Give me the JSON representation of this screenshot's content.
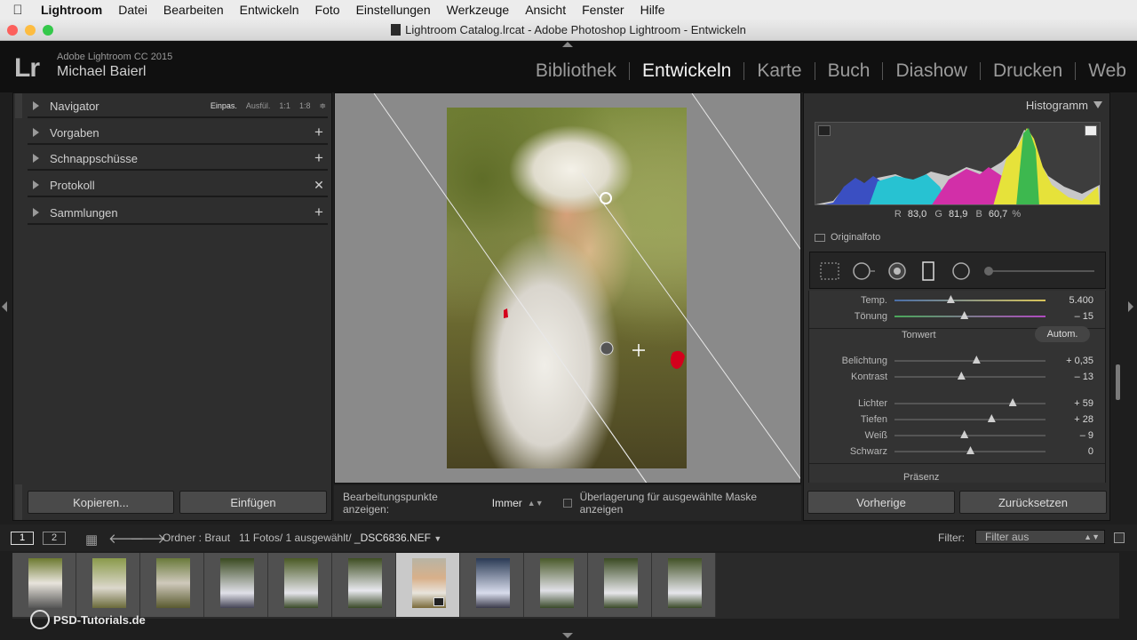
{
  "menubar": {
    "app": "Lightroom",
    "items": [
      "Datei",
      "Bearbeiten",
      "Entwickeln",
      "Foto",
      "Einstellungen",
      "Werkzeuge",
      "Ansicht",
      "Fenster",
      "Hilfe"
    ]
  },
  "window": {
    "title": "Lightroom Catalog.lrcat - Adobe Photoshop Lightroom - Entwickeln"
  },
  "identity": {
    "logo": "Lr",
    "product": "Adobe Lightroom CC 2015",
    "user": "Michael Baierl"
  },
  "modules": [
    "Bibliothek",
    "Entwickeln",
    "Karte",
    "Buch",
    "Diashow",
    "Drucken",
    "Web"
  ],
  "active_module": "Entwickeln",
  "left_panel": {
    "navigator": {
      "label": "Navigator",
      "zoom": [
        "Einpas.",
        "Ausfül.",
        "1:1",
        "1:8"
      ],
      "zoom_arrows": "≑"
    },
    "presets": "Vorgaben",
    "snapshots": "Schnappschüsse",
    "history": "Protokoll",
    "collections": "Sammlungen",
    "copy_button": "Kopieren...",
    "paste_button": "Einfügen"
  },
  "toolbar": {
    "show_points_label": "Bearbeitungspunkte anzeigen:",
    "show_points_value": "Immer",
    "overlay_label": "Überlagerung für ausgewählte Maske anzeigen"
  },
  "right_panel": {
    "histogram_title": "Histogramm",
    "readout": {
      "R_label": "R",
      "R": "83,0",
      "G_label": "G",
      "G": "81,9",
      "B_label": "B",
      "B": "60,7",
      "unit": "%"
    },
    "original_photo": "Originalfoto",
    "tonwert_header": "Tonwert",
    "auto_button": "Autom.",
    "presence_header": "Präsenz",
    "sliders": [
      {
        "label": "Temp.",
        "value": "5.400",
        "position": 0.37
      },
      {
        "label": "Tönung",
        "value": "– 15",
        "position": 0.46
      },
      {
        "label": "Belichtung",
        "value": "+ 0,35",
        "position": 0.54
      },
      {
        "label": "Kontrast",
        "value": "– 13",
        "position": 0.44
      },
      {
        "label": "Lichter",
        "value": "+ 59",
        "position": 0.78
      },
      {
        "label": "Tiefen",
        "value": "+ 28",
        "position": 0.64
      },
      {
        "label": "Weiß",
        "value": "– 9",
        "position": 0.46
      },
      {
        "label": "Schwarz",
        "value": "0",
        "position": 0.5
      }
    ],
    "previous_button": "Vorherige",
    "reset_button": "Zurücksetzen"
  },
  "filmstrip_bar": {
    "view1": "1",
    "view2": "2",
    "folder_text": "Ordner : Braut",
    "count_text": "11 Fotos/ 1 ausgewählt/",
    "filename": "_DSC6836.NEF",
    "filter_label": "Filter:",
    "filter_value": "Filter aus"
  },
  "filmstrip": {
    "thumb_count": 11,
    "selected_index": 6
  },
  "watermark": "PSD-Tutorials.de",
  "colors": {
    "menubar_bg": "#ececec",
    "panel_bg": "#2e2e2e",
    "canvas_bg": "#8a8a8a",
    "mask_red": "#d4001c"
  }
}
